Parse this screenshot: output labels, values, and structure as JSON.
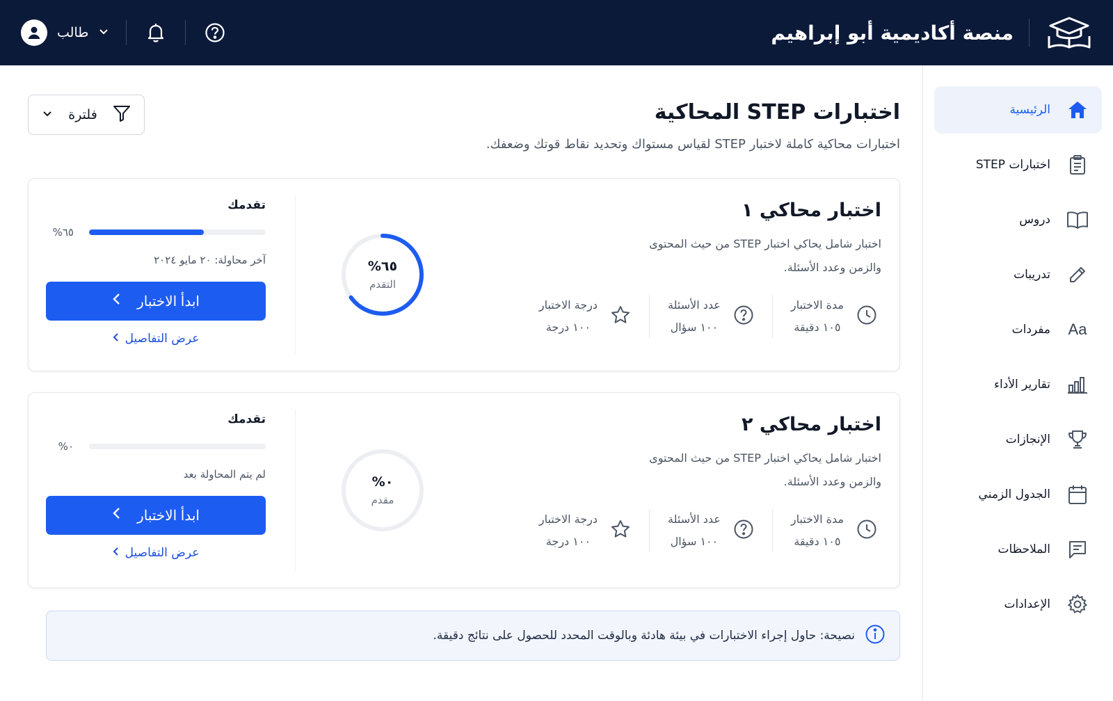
{
  "header": {
    "brand_title": "منصة أكاديمية أبو إبراهيم",
    "user_name": "طالب",
    "icons": [
      "graduation-cap-icon",
      "bell-icon",
      "help-icon",
      "user-icon",
      "chevron-down-icon"
    ]
  },
  "sidebar": {
    "items": [
      {
        "label": "الرئيسية",
        "icon": "home-icon",
        "active": true
      },
      {
        "label": "اختبارات STEP",
        "icon": "clipboard-icon"
      },
      {
        "label": "دروس",
        "icon": "book-icon"
      },
      {
        "label": "تدريبات",
        "icon": "pencil-icon"
      },
      {
        "label": "مفردات",
        "icon": "Aa"
      },
      {
        "label": "تقارير الأداء",
        "icon": "bar-chart-icon"
      },
      {
        "label": "الإنجازات",
        "icon": "trophy-icon"
      },
      {
        "label": "الجدول الزمني",
        "icon": "calendar-icon"
      },
      {
        "label": "الملاحظات",
        "icon": "notes-icon"
      },
      {
        "label": "الإعدادات",
        "icon": "gear-icon"
      }
    ]
  },
  "page": {
    "title": "اختبارات STEP المحاكية",
    "subtitle": "اختبارات محاكية كاملة لاختبار STEP لقياس مستواك وتحديد نقاط قوتك وضعفك.",
    "filter_label": "فلترة"
  },
  "tests": [
    {
      "title": "اختبار محاكي ١",
      "description": "اختبار شامل يحاكي اختبار STEP من حيث المحتوى والزمن وعدد الأسئلة.",
      "duration_label": "مدة الاختبار",
      "duration_value": "١٠٥ دقيقة",
      "questions_label": "عدد الأسئلة",
      "questions_value": "١٠٠ سؤال",
      "score_label": "درجة الاختبار",
      "score_value": "١٠٠ درجة",
      "ring_text": "٦٥%",
      "ring_sub": "التقدم",
      "progress_fraction": 0.65,
      "progress_title": "تقدمك",
      "progress_text": "٦٥%",
      "status_text": "آخر محاولة: ٢٠ مايو ٢٠٢٤",
      "start_label": "ابدأ الاختبار",
      "details_label": "عرض التفاصيل"
    },
    {
      "title": "اختبار محاكي ٢",
      "description": "اختبار شامل يحاكي اختبار STEP من حيث المحتوى والزمن وعدد الأسئلة.",
      "duration_label": "مدة الاختبار",
      "duration_value": "١٠٥ دقيقة",
      "questions_label": "عدد الأسئلة",
      "questions_value": "١٠٠ سؤال",
      "score_label": "درجة الاختبار",
      "score_value": "١٠٠ درجة",
      "ring_text": "٠%",
      "ring_sub": "مقدم",
      "progress_fraction": 0,
      "progress_title": "تقدمك",
      "progress_text": "٠%",
      "status_text": "لم يتم المحاولة بعد",
      "start_label": "ابدأ الاختبار",
      "details_label": "عرض التفاصيل"
    }
  ],
  "tip": {
    "text": "نصيحة: حاول إجراء الاختبارات في بيئة هادئة وبالوقت المحدد للحصول على نتائج دقيقة."
  },
  "colors": {
    "topbar": "#0c1a3a",
    "accent": "#1d5cf0",
    "active_bg": "#eef2fb",
    "tip_bg": "#f2f6fc"
  }
}
